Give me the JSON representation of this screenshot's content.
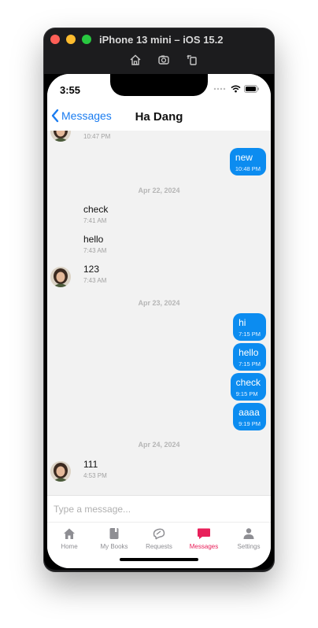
{
  "window": {
    "title": "iPhone 13 mini – iOS 15.2"
  },
  "status": {
    "time": "3:55"
  },
  "nav": {
    "back_label": "Messages",
    "title": "Ha Dang"
  },
  "chat": {
    "top_time": "10:47 PM",
    "out1": {
      "text": "new",
      "time": "10:48 PM"
    },
    "date1": "Apr 22, 2024",
    "in1": {
      "text": "check",
      "time": "7:41 AM"
    },
    "in2": {
      "text": "hello",
      "time": "7:43 AM"
    },
    "in3": {
      "text": "123",
      "time": "7:43 AM"
    },
    "date2": "Apr 23, 2024",
    "out2": {
      "text": "hi",
      "time": "7:15 PM"
    },
    "out3": {
      "text": "hello",
      "time": "7:15 PM"
    },
    "out4": {
      "text": "check",
      "time": "9:15 PM"
    },
    "out5": {
      "text": "aaaa",
      "time": "9:19 PM"
    },
    "date3": "Apr 24, 2024",
    "in4": {
      "text": "111",
      "time": "4:53 PM"
    }
  },
  "composer": {
    "placeholder": "Type a message..."
  },
  "tabs": {
    "home": "Home",
    "books": "My Books",
    "requests": "Requests",
    "messages": "Messages",
    "settings": "Settings"
  },
  "colors": {
    "accent": "#1a7cf0",
    "bubble_out": "#0c8cf0",
    "active_tab": "#e8205a",
    "tab_inactive": "#8e8e93"
  },
  "icons": [
    "home-icon",
    "book-icon",
    "requests-icon",
    "chat-icon",
    "person-icon",
    "wifi-icon",
    "battery-icon",
    "chevron-left-icon"
  ]
}
